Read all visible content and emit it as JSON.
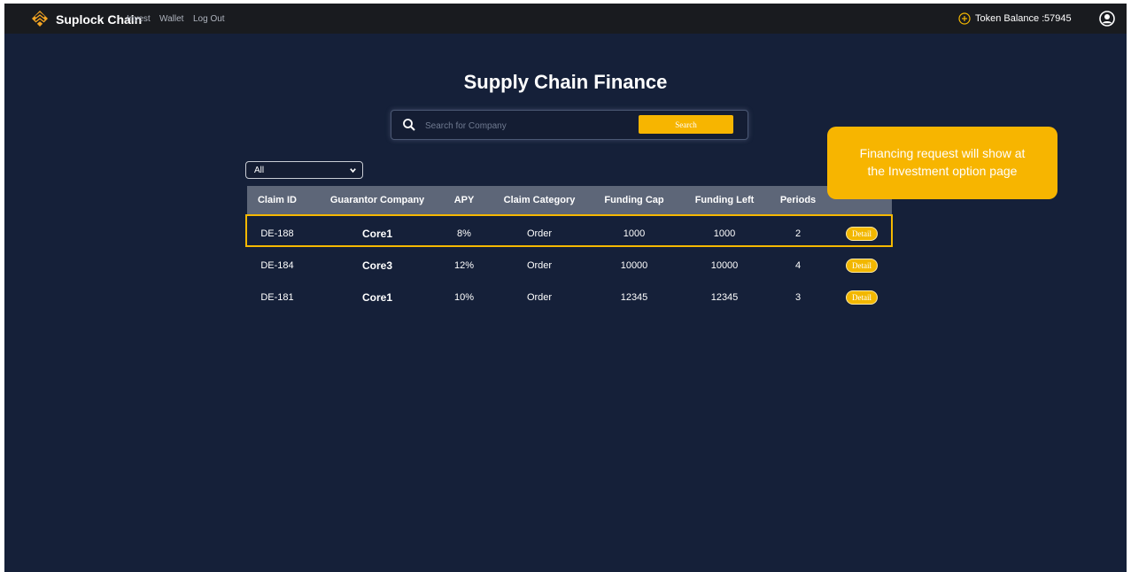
{
  "navbar": {
    "brand": "Suplock Chain",
    "links": [
      "Invest",
      "Wallet",
      "Log Out"
    ],
    "token_label": "Token Balance :",
    "token_value": "57945",
    "icons": {
      "logo": "suplock-logo",
      "token": "plus-circle-icon",
      "user": "user-circle-icon"
    }
  },
  "page": {
    "title": "Supply Chain Finance"
  },
  "search": {
    "placeholder": "Search for Company",
    "value": "",
    "button_label": "Search"
  },
  "filter": {
    "selected": "All"
  },
  "table": {
    "headers": [
      "Claim ID",
      "Guarantor Company",
      "APY",
      "Claim Category",
      "Funding Cap",
      "Funding Left",
      "Periods",
      ""
    ],
    "rows": [
      {
        "claim_id": "DE-188",
        "company": "Core1",
        "apy": "8%",
        "category": "Order",
        "funding_cap": "1000",
        "funding_left": "1000",
        "periods": "2",
        "action": "Detail"
      },
      {
        "claim_id": "DE-184",
        "company": "Core3",
        "apy": "12%",
        "category": "Order",
        "funding_cap": "10000",
        "funding_left": "10000",
        "periods": "4",
        "action": "Detail"
      },
      {
        "claim_id": "DE-181",
        "company": "Core1",
        "apy": "10%",
        "category": "Order",
        "funding_cap": "12345",
        "funding_left": "12345",
        "periods": "3",
        "action": "Detail"
      }
    ]
  },
  "callout": {
    "line1": "Financing request will show at",
    "line2": "the Investment option page"
  },
  "colors": {
    "background": "#152039",
    "navbar": "#191b1f",
    "accent": "#f7b500",
    "header_row": "#5d6678"
  }
}
